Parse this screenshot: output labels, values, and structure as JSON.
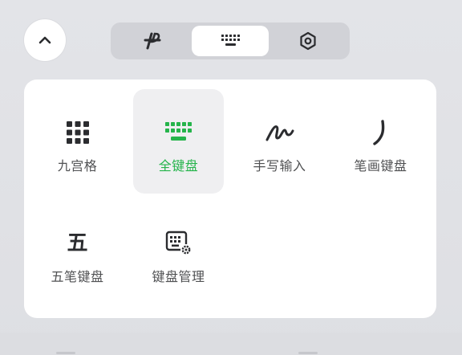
{
  "top_bar": {
    "collapse_icon": "chevron-up-icon",
    "tabs": [
      {
        "id": "gesture",
        "icon": "gesture-p-icon",
        "active": false
      },
      {
        "id": "keyboard",
        "icon": "keyboard-icon",
        "active": true
      },
      {
        "id": "settings",
        "icon": "hexagon-settings-icon",
        "active": false
      }
    ]
  },
  "options": [
    {
      "id": "nine-grid",
      "label": "九宫格",
      "icon": "nine-grid-icon",
      "selected": false
    },
    {
      "id": "full-keyboard",
      "label": "全键盘",
      "icon": "full-keyboard-icon",
      "selected": true
    },
    {
      "id": "handwriting",
      "label": "手写输入",
      "icon": "handwriting-icon",
      "selected": false
    },
    {
      "id": "stroke-keyboard",
      "label": "笔画键盘",
      "icon": "stroke-icon",
      "selected": false
    },
    {
      "id": "wubi-keyboard",
      "label": "五笔键盘",
      "icon_text": "五",
      "icon": "wubi-icon",
      "selected": false
    },
    {
      "id": "keyboard-manage",
      "label": "键盘管理",
      "icon": "keyboard-settings-icon",
      "selected": false
    }
  ],
  "colors": {
    "accent": "#25b44b",
    "text": "#505153",
    "icon": "#2b2c2f",
    "panel": "#e1e2e6",
    "card": "#ffffff"
  }
}
